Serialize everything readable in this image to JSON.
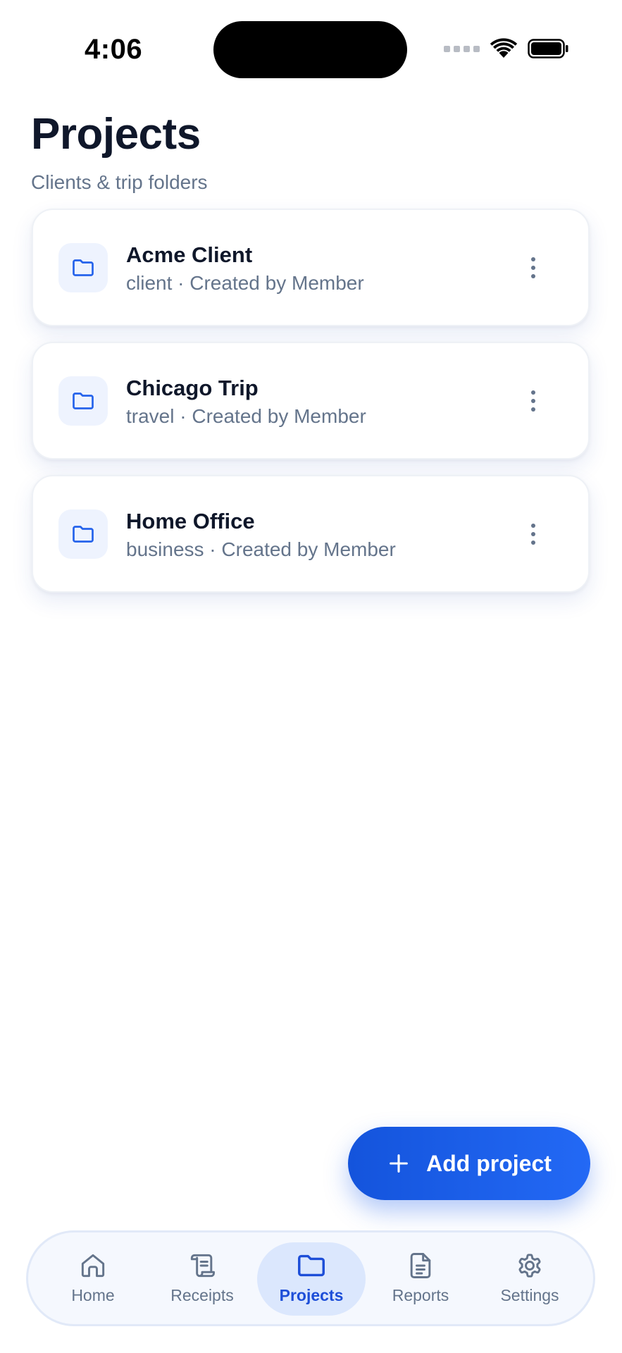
{
  "status_bar": {
    "time": "4:06"
  },
  "header": {
    "title": "Projects",
    "subtitle": "Clients & trip folders"
  },
  "projects": [
    {
      "name": "Acme Client",
      "meta": "client · Created by Member",
      "icon": "folder-icon"
    },
    {
      "name": "Chicago Trip",
      "meta": "travel · Created by Member",
      "icon": "folder-icon"
    },
    {
      "name": "Home Office",
      "meta": "business · Created by Member",
      "icon": "folder-icon"
    }
  ],
  "fab": {
    "label": "Add project",
    "icon": "plus-icon"
  },
  "tab_bar": {
    "active": "Projects",
    "tabs": [
      {
        "label": "Home",
        "icon": "home-icon"
      },
      {
        "label": "Receipts",
        "icon": "receipt-icon"
      },
      {
        "label": "Projects",
        "icon": "folder-icon"
      },
      {
        "label": "Reports",
        "icon": "document-icon"
      },
      {
        "label": "Settings",
        "icon": "gear-icon"
      }
    ]
  },
  "colors": {
    "accent": "#2563eb",
    "title": "#0f172a",
    "muted": "#64748b",
    "tab_active_bg": "#dbe7fd"
  }
}
